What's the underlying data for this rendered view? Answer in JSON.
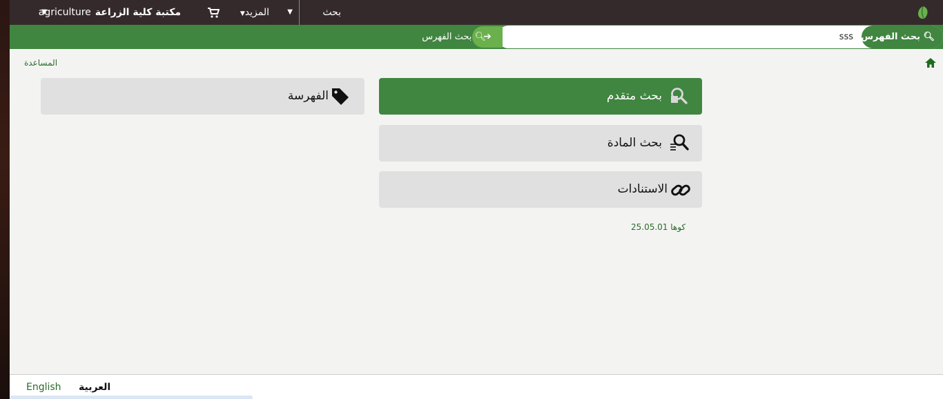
{
  "topbar": {
    "search_label": "بحث",
    "more_label": "المزيد",
    "library_name_ar": "مكتبة كلية الزراعة",
    "library_name_en": "agriculture"
  },
  "searchbar": {
    "button_label": "بحث الفهرس",
    "query_value": "sss",
    "catalog_link": "بحث الفهرس"
  },
  "breadcrumb": {
    "help": "المساعدة"
  },
  "tiles": {
    "advanced_search": "بحث متقدم",
    "item_search": "بحث المادة",
    "authorities": "الاستنادات",
    "cataloging": "الفهرسة"
  },
  "version": {
    "text": "كوها 25.05.01"
  },
  "footer": {
    "lang_ar": "العربية",
    "lang_en": "English"
  },
  "colors": {
    "primary_green": "#408540",
    "topbar": "#352a2b",
    "tile_bg": "#e0e0e0"
  }
}
